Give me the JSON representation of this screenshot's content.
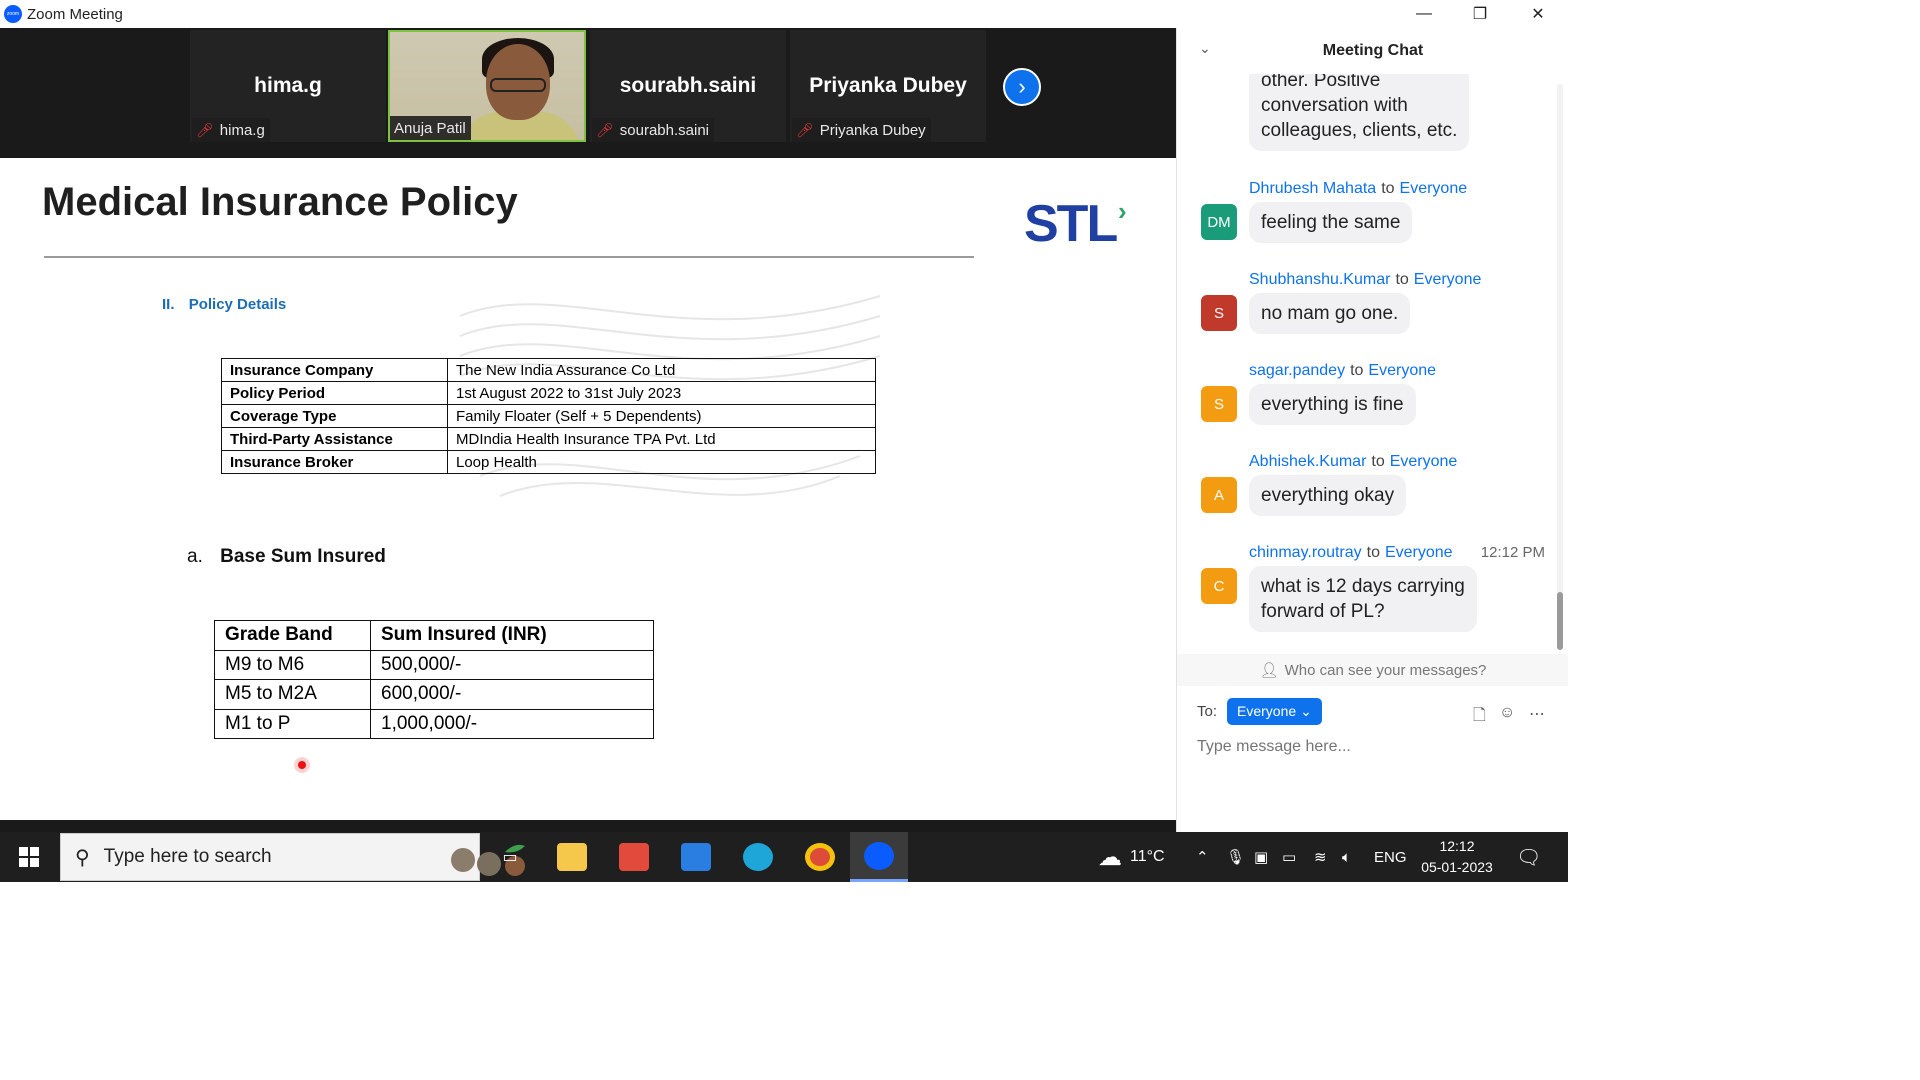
{
  "window": {
    "title": "Zoom Meeting",
    "minimize_icon": "—",
    "restore_icon": "❐",
    "close_icon": "✕"
  },
  "video_strip": {
    "tiles": [
      {
        "big_name": "hima.g",
        "label": "hima.g",
        "muted": true
      },
      {
        "big_name": "",
        "label": "Anuja Patil",
        "muted": false,
        "active_speaker": true
      },
      {
        "big_name": "sourabh.saini",
        "label": "sourabh.saini",
        "muted": true
      },
      {
        "big_name": "Priyanka Dubey",
        "label": "Priyanka Dubey",
        "muted": true
      }
    ],
    "next_icon": "›"
  },
  "slide": {
    "title": "Medical Insurance Policy",
    "logo_text": "STL",
    "section": {
      "roman": "II.",
      "label": "Policy Details"
    },
    "policy_table": [
      {
        "key": "Insurance Company",
        "value": "The New India Assurance Co Ltd"
      },
      {
        "key": "Policy Period",
        "value": "1st August 2022 to 31st July 2023"
      },
      {
        "key": "Coverage Type",
        "value": "Family Floater (Self + 5 Dependents)"
      },
      {
        "key": "Third-Party Assistance",
        "value": "MDIndia Health Insurance TPA Pvt. Ltd"
      },
      {
        "key": "Insurance Broker",
        "value": "Loop Health"
      }
    ],
    "subsection": {
      "letter": "a.",
      "label": "Base Sum Insured"
    },
    "sum_table": {
      "headers": [
        "Grade Band",
        "Sum Insured (INR)"
      ],
      "rows": [
        [
          "M9 to M6",
          "500,000/-"
        ],
        [
          "M5 to M2A",
          "600,000/-"
        ],
        [
          "M1 to P",
          "1,000,000/-"
        ]
      ]
    }
  },
  "chat": {
    "title": "Meeting Chat",
    "collapse_icon": "⌄",
    "to_word": "to",
    "messages": [
      {
        "partial": true,
        "text_lines": [
          "other. Positive",
          "conversation with",
          "colleagues, clients, etc."
        ]
      },
      {
        "sender": "Dhrubesh Mahata",
        "recipient": "Everyone",
        "initials": "DM",
        "color": "#1a9c7a",
        "text": "feeling the same"
      },
      {
        "sender": "Shubhanshu.Kumar",
        "recipient": "Everyone",
        "initials": "S",
        "color": "#c0392b",
        "text": "no mam go one."
      },
      {
        "sender": "sagar.pandey",
        "recipient": "Everyone",
        "initials": "S",
        "color": "#f39c12",
        "text": "everything is fine"
      },
      {
        "sender": "Abhishek.Kumar",
        "recipient": "Everyone",
        "initials": "A",
        "color": "#f39c12",
        "text": "everything okay"
      },
      {
        "sender": "chinmay.routray",
        "recipient": "Everyone",
        "initials": "C",
        "color": "#f39c12",
        "time": "12:12 PM",
        "text_lines": [
          "what is 12 days carrying",
          "forward of PL?"
        ]
      }
    ],
    "who_can_see": "Who can see your messages?",
    "to_label": "To:",
    "to_value": "Everyone",
    "input_placeholder": "Type message here...",
    "tool_icons": [
      "file-icon",
      "emoji-icon",
      "more-icon"
    ]
  },
  "taskbar": {
    "search_placeholder": "Type here to search",
    "weather": "11°C",
    "language": "ENG",
    "time": "12:12",
    "date": "05-01-2023",
    "colors": {
      "explorer": "#f5c84c",
      "store": "#e24b3c",
      "mail": "#2a7de1",
      "edge": "#1fa6d9",
      "chrome": "#dd4b39",
      "zoom": "#0b5cff"
    }
  }
}
